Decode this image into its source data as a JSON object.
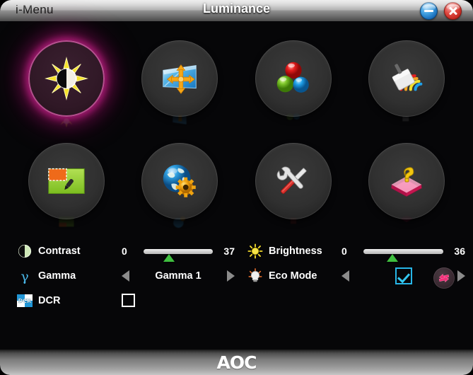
{
  "titlebar": {
    "app_name": "i-Menu",
    "page_title": "Luminance",
    "minimize_label": "minimize",
    "close_label": "close"
  },
  "menu_icons": [
    {
      "id": "luminance",
      "label": "Luminance",
      "icon": "sun-contrast-icon",
      "selected": true,
      "glow_color": "#e028a0"
    },
    {
      "id": "image-setup",
      "label": "Image Setup",
      "icon": "screen-arrows-icon",
      "selected": false,
      "glow_color": ""
    },
    {
      "id": "color-setup",
      "label": "Color Setup",
      "icon": "rgb-spheres-icon",
      "selected": false,
      "glow_color": ""
    },
    {
      "id": "picture-boost",
      "label": "Picture Boost",
      "icon": "paint-rainbow-icon",
      "selected": false,
      "glow_color": ""
    },
    {
      "id": "osd-region",
      "label": "OSD Region",
      "icon": "green-screen-icon",
      "selected": false,
      "glow_color": ""
    },
    {
      "id": "osd-setup",
      "label": "OSD Setup",
      "icon": "globe-gear-icon",
      "selected": false,
      "glow_color": ""
    },
    {
      "id": "extra",
      "label": "Extra",
      "icon": "wrench-screwdriver-icon",
      "selected": false,
      "glow_color": ""
    },
    {
      "id": "help",
      "label": "Help",
      "icon": "book-question-icon",
      "selected": false,
      "glow_color": ""
    }
  ],
  "controls": {
    "left": {
      "contrast": {
        "icon": "contrast-circle-icon",
        "label": "Contrast",
        "min": "0",
        "max": "37",
        "value": 37,
        "range_min": 0,
        "range_max": 100
      },
      "gamma": {
        "icon": "gamma-symbol-icon",
        "label": "Gamma",
        "value": "Gamma 1",
        "prev_label": "previous",
        "next_label": "next"
      },
      "dcr": {
        "icon": "dcr-badge-icon",
        "label": "DCR",
        "checked": false
      }
    },
    "right": {
      "brightness": {
        "icon": "sun-icon",
        "label": "Brightness",
        "min": "0",
        "max": "36",
        "value": 36,
        "range_min": 0,
        "range_max": 100
      },
      "eco_mode": {
        "icon": "eco-bulb-icon",
        "label": "Eco Mode",
        "checked": true,
        "prev_label": "previous",
        "next_label": "next"
      }
    },
    "reset": {
      "icon": "reset-arrows-icon",
      "label": "Reset"
    }
  },
  "bottombar": {
    "brand": "AOC"
  },
  "colors": {
    "accent_green": "#3fbf3f",
    "accent_cyan": "#27b6e8",
    "selected_glow": "#e028a0",
    "text": "#ffffff",
    "panel_bg": "#060608"
  }
}
